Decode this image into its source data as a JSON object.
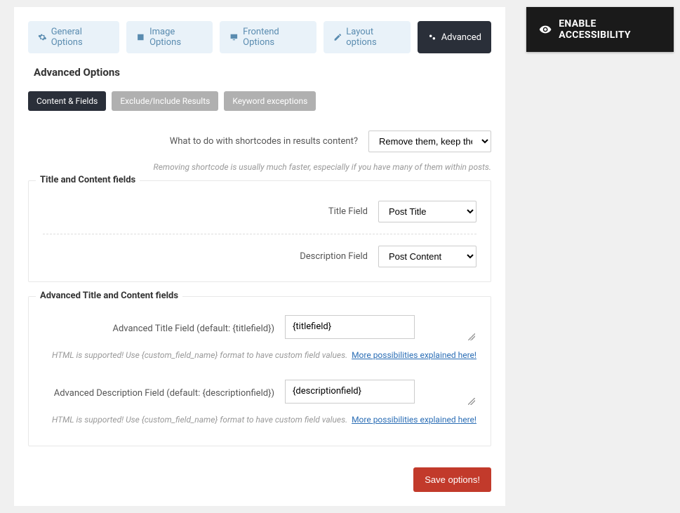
{
  "accessibility": {
    "label": "ENABLE ACCESSIBILITY"
  },
  "tabs": {
    "general": "General Options",
    "image": "Image Options",
    "frontend": "Frontend Options",
    "layout": "Layout options",
    "advanced": "Advanced"
  },
  "section_title": "Advanced Options",
  "sub_tabs": {
    "content": "Content & Fields",
    "exclude": "Exclude/Include Results",
    "keyword": "Keyword exceptions"
  },
  "shortcode": {
    "label": "What to do with shortcodes in results content?",
    "selected": "Remove them, keep the content",
    "help": "Removing shortcode is usually much faster, especially if you have many of them within posts."
  },
  "title_content": {
    "legend": "Title and Content fields",
    "title_label": "Title Field",
    "title_selected": "Post Title",
    "desc_label": "Description Field",
    "desc_selected": "Post Content"
  },
  "advanced_fields": {
    "legend": "Advanced Title and Content fields",
    "title_label": "Advanced Title Field (default: {titlefield})",
    "title_value": "{titlefield}",
    "desc_label": "Advanced Description Field (default: {descriptionfield})",
    "desc_value": "{descriptionfield}",
    "help": "HTML is supported! Use {custom_field_name} format to have custom field values.",
    "link": "More possibilities explained here!"
  },
  "save": {
    "label": "Save options!"
  }
}
